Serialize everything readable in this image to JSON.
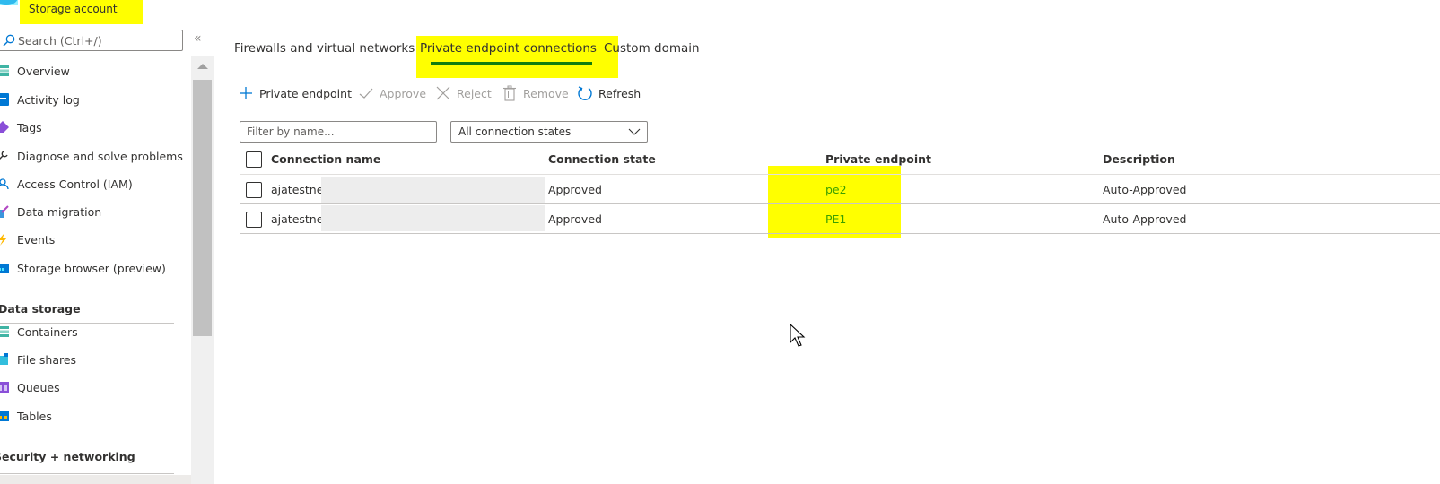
{
  "header": {
    "title": "Storage account"
  },
  "sidebar": {
    "search_placeholder": "Search (Ctrl+/)",
    "collapse_glyph": "«",
    "items": [
      {
        "label": "Overview",
        "icon": "overview-icon",
        "color": "#40b4a4"
      },
      {
        "label": "Activity log",
        "icon": "activity-log-icon",
        "color": "#0078d4"
      },
      {
        "label": "Tags",
        "icon": "tag-icon",
        "color": "#8a4fd8"
      },
      {
        "label": "Diagnose and solve problems",
        "icon": "wrench-icon",
        "color": "#323130"
      },
      {
        "label": "Access Control (IAM)",
        "icon": "people-icon",
        "color": "#0078d4"
      },
      {
        "label": "Data migration",
        "icon": "data-migration-icon",
        "color": "#3a96dd"
      },
      {
        "label": "Events",
        "icon": "lightning-icon",
        "color": "#ffb900"
      },
      {
        "label": "Storage browser (preview)",
        "icon": "storage-browser-icon",
        "color": "#0078d4"
      }
    ],
    "sections": [
      {
        "title": "Data storage",
        "items": [
          {
            "label": "Containers",
            "icon": "containers-icon",
            "color": "#40b4a4"
          },
          {
            "label": "File shares",
            "icon": "file-shares-icon",
            "color": "#32bedd"
          },
          {
            "label": "Queues",
            "icon": "queues-icon",
            "color": "#8a4fd8"
          },
          {
            "label": "Tables",
            "icon": "tables-icon",
            "color": "#0078d4"
          }
        ]
      },
      {
        "title": "Security + networking",
        "items": []
      }
    ]
  },
  "main": {
    "tabs": [
      {
        "label": "Firewalls and virtual networks",
        "active": false
      },
      {
        "label": "Private endpoint connections",
        "active": true
      },
      {
        "label": "Custom domain",
        "active": false
      }
    ],
    "toolbar": {
      "add_label": "Private endpoint",
      "approve_label": "Approve",
      "reject_label": "Reject",
      "remove_label": "Remove",
      "refresh_label": "Refresh"
    },
    "filter": {
      "placeholder": "Filter by name...",
      "value": ""
    },
    "state_dropdown": {
      "selected": "All connection states"
    },
    "table": {
      "columns": [
        "Connection name",
        "Connection state",
        "Private endpoint",
        "Description"
      ],
      "rows": [
        {
          "name": "ajatestnet",
          "state": "Approved",
          "endpoint": "pe2",
          "description": "Auto-Approved"
        },
        {
          "name": "ajatestnet",
          "state": "Approved",
          "endpoint": "PE1",
          "description": "Auto-Approved"
        }
      ]
    }
  },
  "colors": {
    "accent_green": "#107c10",
    "link_green": "#3aa000",
    "highlight": "#ffff00",
    "refresh_blue": "#0078d4"
  }
}
